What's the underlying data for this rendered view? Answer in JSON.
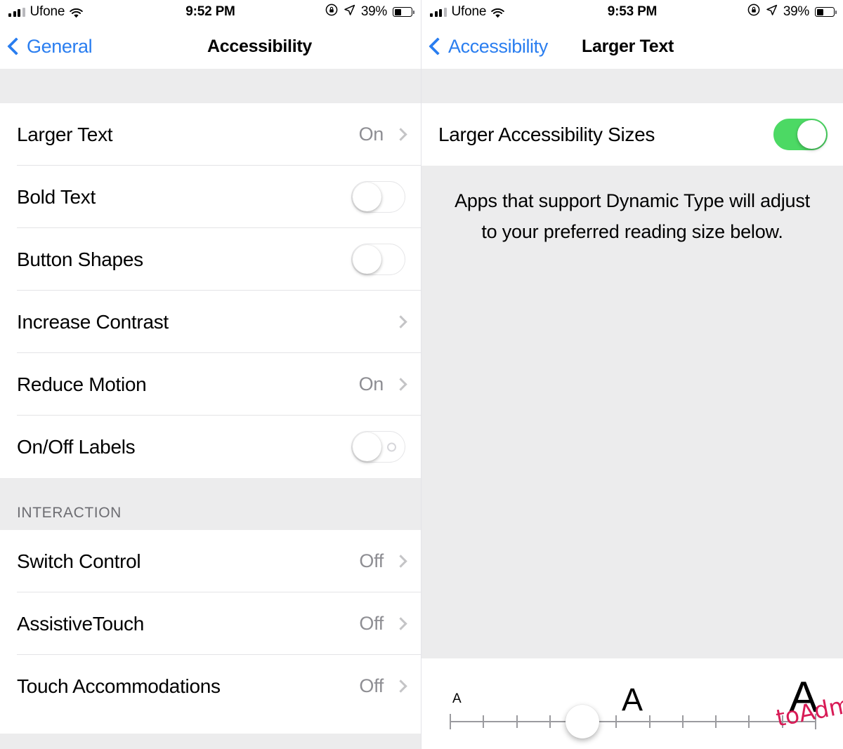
{
  "watermark": "toAdmin.ru",
  "colors": {
    "accent_blue": "#2a7ef0",
    "toggle_on_green": "#4cd964",
    "group_background": "#ececed",
    "secondary_text": "#8e8e93",
    "watermark_pink": "#d81b56"
  },
  "left_screen": {
    "status_bar": {
      "carrier": "Ufone",
      "time": "9:52 PM",
      "battery_percent": "39%",
      "icons": [
        "signal-bars-icon",
        "wifi-icon",
        "rotation-lock-icon",
        "location-arrow-icon",
        "battery-icon"
      ]
    },
    "nav": {
      "back_label": "General",
      "title": "Accessibility"
    },
    "rows": [
      {
        "label": "Larger Text",
        "type": "disclosure",
        "value": "On"
      },
      {
        "label": "Bold Text",
        "type": "toggle",
        "value": "off"
      },
      {
        "label": "Button Shapes",
        "type": "toggle",
        "value": "off"
      },
      {
        "label": "Increase Contrast",
        "type": "disclosure",
        "value": ""
      },
      {
        "label": "Reduce Motion",
        "type": "disclosure",
        "value": "On"
      },
      {
        "label": "On/Off Labels",
        "type": "toggle",
        "value": "off"
      }
    ],
    "section_header": "INTERACTION",
    "interaction_rows": [
      {
        "label": "Switch Control",
        "type": "disclosure",
        "value": "Off"
      },
      {
        "label": "AssistiveTouch",
        "type": "disclosure",
        "value": "Off"
      },
      {
        "label": "Touch Accommodations",
        "type": "disclosure",
        "value": "Off"
      }
    ]
  },
  "right_screen": {
    "status_bar": {
      "carrier": "Ufone",
      "time": "9:53 PM",
      "battery_percent": "39%"
    },
    "nav": {
      "back_label": "Accessibility",
      "title": "Larger Text"
    },
    "toggle_row": {
      "label": "Larger Accessibility Sizes",
      "value": "on"
    },
    "description": "Apps that support Dynamic Type will adjust to your preferred reading size below.",
    "slider": {
      "small_label": "A",
      "medium_label": "A",
      "large_label": "A",
      "tick_count": 12,
      "value_index": 4,
      "min_index": 0,
      "max_index": 11
    }
  }
}
